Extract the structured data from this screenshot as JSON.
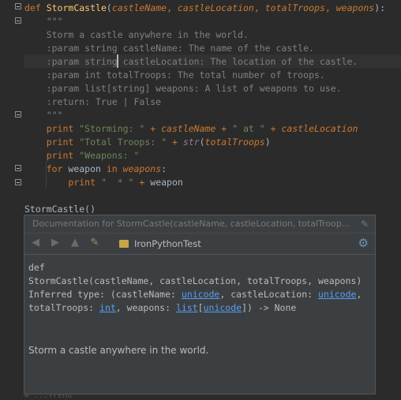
{
  "editor": {
    "lines": [
      [
        {
          "t": "def ",
          "c": "kw"
        },
        {
          "t": "StormCastle",
          "c": "fn"
        },
        {
          "t": "(",
          "c": ""
        },
        {
          "t": "castleName",
          "c": "param"
        },
        {
          "t": ", ",
          "c": "op"
        },
        {
          "t": "castleLocation",
          "c": "param"
        },
        {
          "t": ", ",
          "c": "op"
        },
        {
          "t": "totalTroops",
          "c": "param"
        },
        {
          "t": ", ",
          "c": "op"
        },
        {
          "t": "weapons",
          "c": "param"
        },
        {
          "t": "):",
          "c": ""
        }
      ],
      [
        {
          "t": "    \"\"\"",
          "c": "docmuted"
        }
      ],
      [
        {
          "t": "    Storm a castle anywhere in the world.",
          "c": "docmuted"
        }
      ],
      [
        {
          "t": "    :param string castleName: The name of the castle.",
          "c": "docmuted"
        }
      ],
      [
        {
          "t": "    :param string castleLocation: The location of the castle.",
          "c": "docmuted"
        }
      ],
      [
        {
          "t": "    :param int totalTroops: The total number of troops.",
          "c": "docmuted"
        }
      ],
      [
        {
          "t": "    :param list[string] weapons: A list of weapons to use.",
          "c": "docmuted"
        }
      ],
      [
        {
          "t": "    :return: True | False",
          "c": "docmuted"
        }
      ],
      [
        {
          "t": "    \"\"\"",
          "c": "docmuted"
        }
      ],
      [
        {
          "t": "    ",
          "c": ""
        },
        {
          "t": "print ",
          "c": "kw"
        },
        {
          "t": "\"Storming: \" ",
          "c": "str"
        },
        {
          "t": "+ ",
          "c": "op"
        },
        {
          "t": "castleName",
          "c": "param"
        },
        {
          "t": " + ",
          "c": "op"
        },
        {
          "t": "\" at \" ",
          "c": "str"
        },
        {
          "t": "+ ",
          "c": "op"
        },
        {
          "t": "castleLocation",
          "c": "param"
        }
      ],
      [
        {
          "t": "    ",
          "c": ""
        },
        {
          "t": "print ",
          "c": "kw"
        },
        {
          "t": "\"Total Troops: \" ",
          "c": "str"
        },
        {
          "t": "+ ",
          "c": "op"
        },
        {
          "t": "str",
          "c": "ivar"
        },
        {
          "t": "(",
          "c": ""
        },
        {
          "t": "totalTroops",
          "c": "param"
        },
        {
          "t": ")",
          "c": ""
        }
      ],
      [
        {
          "t": "    ",
          "c": ""
        },
        {
          "t": "print ",
          "c": "kw"
        },
        {
          "t": "\"Weapons: \"",
          "c": "str"
        }
      ],
      [
        {
          "t": "    ",
          "c": ""
        },
        {
          "t": "for ",
          "c": "kw"
        },
        {
          "t": "weapon ",
          "c": ""
        },
        {
          "t": "in ",
          "c": "kw"
        },
        {
          "t": "weapons",
          "c": "param"
        },
        {
          "t": ":",
          "c": ""
        }
      ],
      [
        {
          "t": "        ",
          "c": ""
        },
        {
          "t": "print ",
          "c": "kw"
        },
        {
          "t": "\"  * \" ",
          "c": "str"
        },
        {
          "t": "+ ",
          "c": "op"
        },
        {
          "t": "weapon",
          "c": ""
        }
      ],
      [
        {
          "t": "",
          "c": ""
        }
      ],
      [
        {
          "t": "StormCastle()",
          "c": ""
        }
      ]
    ],
    "bottom_fragment": "# ...Trend"
  },
  "popup": {
    "title": "Documentation for StormCastle(castleName, castleLocation, totalTroops, w...",
    "project": "IronPythonTest",
    "sig_def": "def",
    "sig_line": "StormCastle(castleName, castleLocation, totalTroops, weapons)",
    "inferred_prefix": "Inferred type: (castleName: ",
    "t_unicode1": "unicode",
    "inferred_mid": ", castleLocation: ",
    "t_unicode2": "unicode",
    "inferred_comma": ",",
    "troops_prefix": "totalTroops: ",
    "t_int": "int",
    "weapons_prefix": ", weapons: ",
    "t_list": "list",
    "bracket_open": "[",
    "t_unicode3": "unicode",
    "bracket_close": "]",
    "returns": ") -> None",
    "description": "Storm a castle anywhere in the world."
  },
  "icons": [
    "back-icon",
    "forward-icon",
    "up-icon",
    "edit-source-icon",
    "project-icon",
    "gear-icon",
    "pin-icon",
    "fold-icon"
  ]
}
